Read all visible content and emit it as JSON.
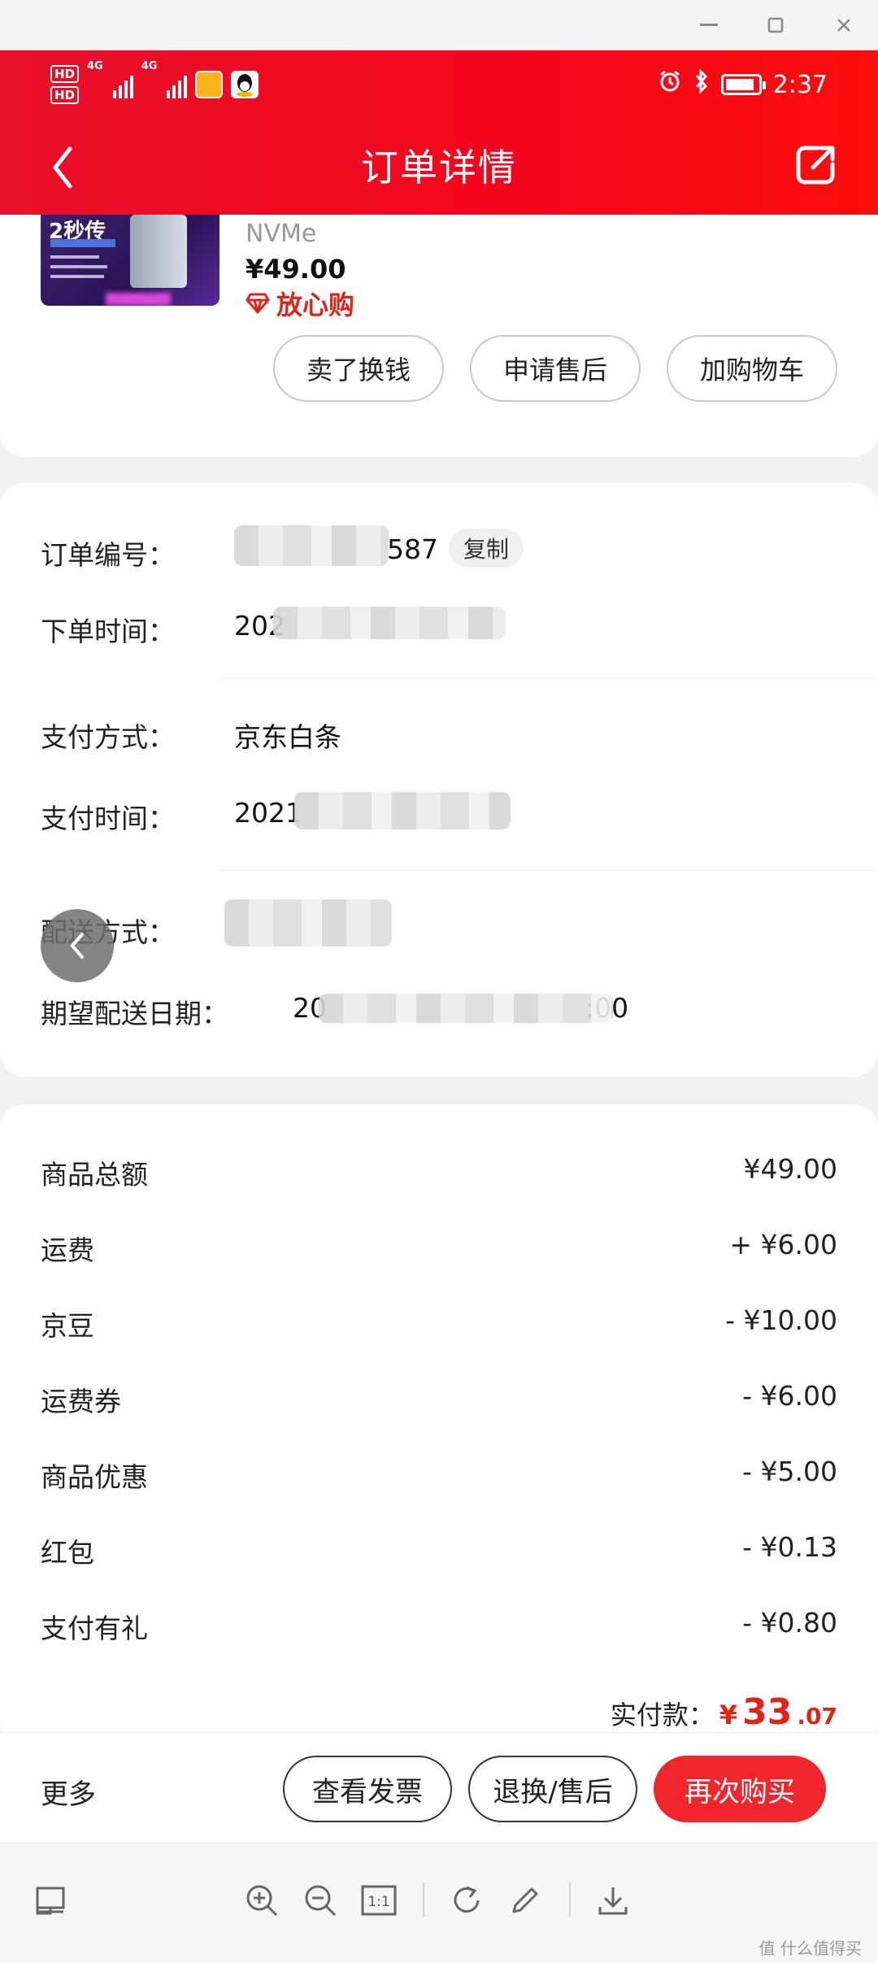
{
  "window": {
    "minimize_icon": "minimize-icon",
    "maximize_icon": "maximize-icon",
    "close_icon": "close-icon"
  },
  "status_bar": {
    "hd1": "HD",
    "hd2": "HD",
    "net1": "4G",
    "net2": "4G",
    "time": "2:37",
    "icons": [
      "alarm-icon",
      "bluetooth-icon",
      "battery-icon"
    ]
  },
  "header": {
    "title": "订单详情",
    "back_icon": "chevron-left-icon",
    "share_icon": "share-icon",
    "color": "#f0061c"
  },
  "product": {
    "thumb_text": "2秒传",
    "subtitle": "NVMe",
    "price": "¥49.00",
    "tag": "放心购",
    "buttons": [
      "卖了换钱",
      "申请售后",
      "加购物车"
    ]
  },
  "order_info": {
    "order_no_label": "订单编号：",
    "order_no_suffix": "587",
    "copy_label": "复制",
    "order_time_label": "下单时间：",
    "order_time_prefix": "202",
    "pay_method_label": "支付方式：",
    "pay_method_value": "京东白条",
    "pay_time_label": "支付时间：",
    "pay_time_prefix": "2021",
    "delivery_label": "配送方式：",
    "expect_date_label": "期望配送日期：",
    "expect_date_prefix": "20",
    "expect_date_suffix": ":00"
  },
  "amounts": {
    "rows": [
      {
        "label": "商品总额",
        "value": "¥49.00"
      },
      {
        "label": "运费",
        "value": "+ ¥6.00"
      },
      {
        "label": "京豆",
        "value": "- ¥10.00"
      },
      {
        "label": "运费券",
        "value": "- ¥6.00"
      },
      {
        "label": "商品优惠",
        "value": "- ¥5.00"
      },
      {
        "label": "红包",
        "value": "- ¥0.13"
      },
      {
        "label": "支付有礼",
        "value": "- ¥0.80"
      }
    ],
    "paid_label": "实付款：",
    "paid_yen": "¥",
    "paid_int": "33",
    "paid_dec": ".07",
    "accent": "#e2231a"
  },
  "action_bar": {
    "more": "更多",
    "view_invoice": "查看发票",
    "return": "退换/售后",
    "buy_again": "再次购买"
  },
  "viewer": {
    "tools": [
      "layout-icon",
      "zoom-in-icon",
      "zoom-out-icon",
      "actual-size-icon",
      "rotate-icon",
      "edit-icon",
      "download-icon"
    ],
    "actual_size_label": "1:1",
    "watermark": "值 什么值得买"
  }
}
